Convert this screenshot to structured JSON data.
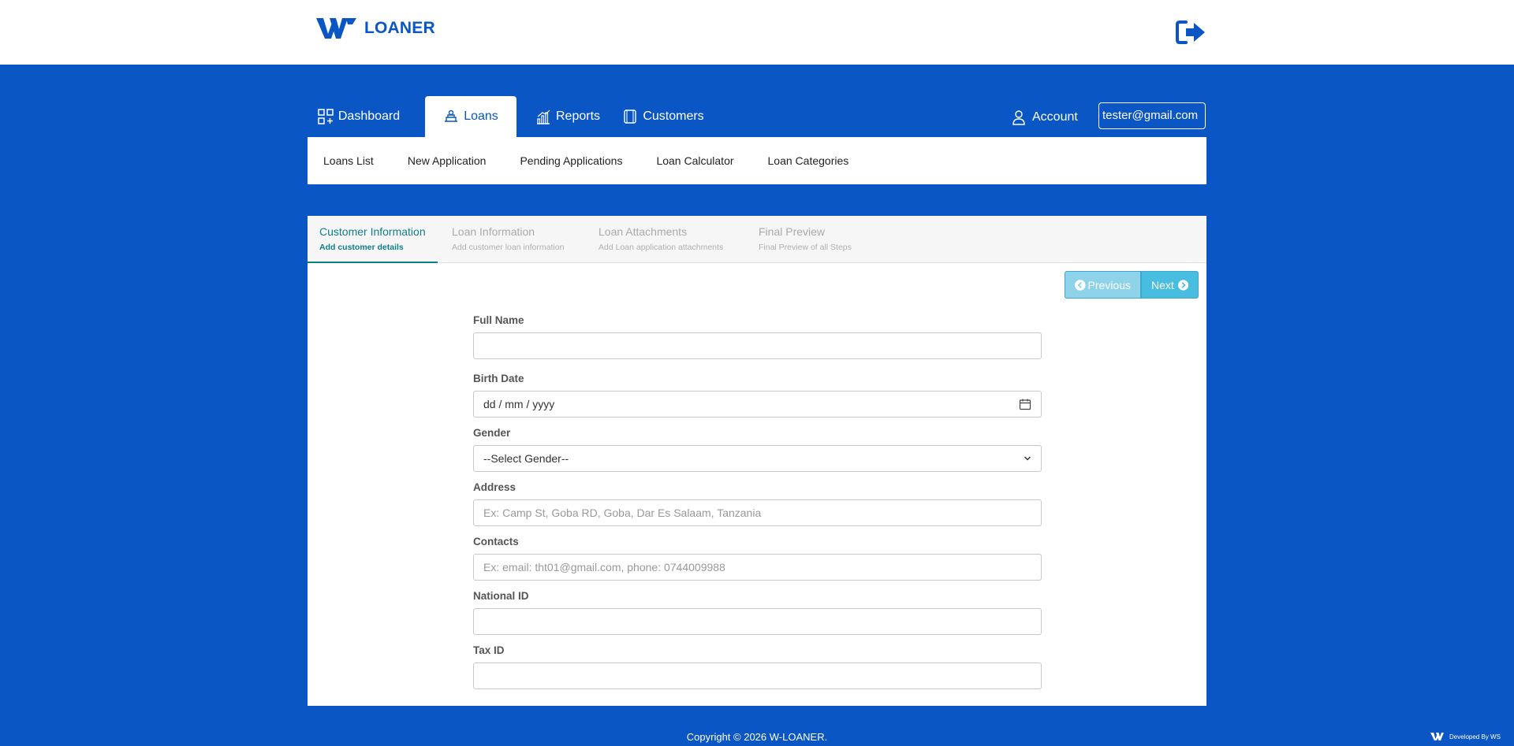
{
  "header": {
    "brand_name": "LOANER",
    "logo_icon": "w-logo-icon",
    "logout_icon": "logout-icon"
  },
  "nav": {
    "tabs": [
      {
        "label": "Dashboard",
        "icon": "grid-icon",
        "active": false
      },
      {
        "label": "Loans",
        "icon": "loan-icon",
        "active": true
      },
      {
        "label": "Reports",
        "icon": "bar-chart-icon",
        "active": false
      },
      {
        "label": "Customers",
        "icon": "customers-icon",
        "active": false
      }
    ],
    "account_label": "Account",
    "user_email": "tester@gmail.com"
  },
  "subnav": {
    "items": [
      "Loans List",
      "New Application",
      "Pending Applications",
      "Loan Calculator",
      "Loan Categories"
    ]
  },
  "wizard": {
    "steps": [
      {
        "title": "Customer Information",
        "subtitle": "Add customer details",
        "active": true
      },
      {
        "title": "Loan Information",
        "subtitle": "Add customer loan information",
        "active": false
      },
      {
        "title": "Loan Attachments",
        "subtitle": "Add Loan application attachments",
        "active": false
      },
      {
        "title": "Final Preview",
        "subtitle": "Final Preview of all Steps",
        "active": false
      }
    ],
    "previous_label": "Previous",
    "next_label": "Next"
  },
  "form": {
    "full_name": {
      "label": "Full Name",
      "value": "",
      "placeholder": ""
    },
    "birth_date": {
      "label": "Birth Date",
      "value": "dd / mm / yyyy"
    },
    "gender": {
      "label": "Gender",
      "selected": "--Select Gender--"
    },
    "address": {
      "label": "Address",
      "value": "",
      "placeholder": "Ex: Camp St, Goba RD, Goba, Dar Es Salaam, Tanzania"
    },
    "contacts": {
      "label": "Contacts",
      "value": "",
      "placeholder": "Ex: email: tht01@gmail.com, phone: 0744009988"
    },
    "national_id": {
      "label": "National ID",
      "value": "",
      "placeholder": ""
    },
    "tax_id": {
      "label": "Tax ID",
      "value": "",
      "placeholder": ""
    }
  },
  "footer": {
    "copyright": "Copyright © 2026  W-LOANER.",
    "developed_by": "Developed By WS"
  },
  "colors": {
    "brand_blue": "#0a56c4",
    "step_active": "#0d7f8a",
    "button_info": "#49bde0"
  }
}
